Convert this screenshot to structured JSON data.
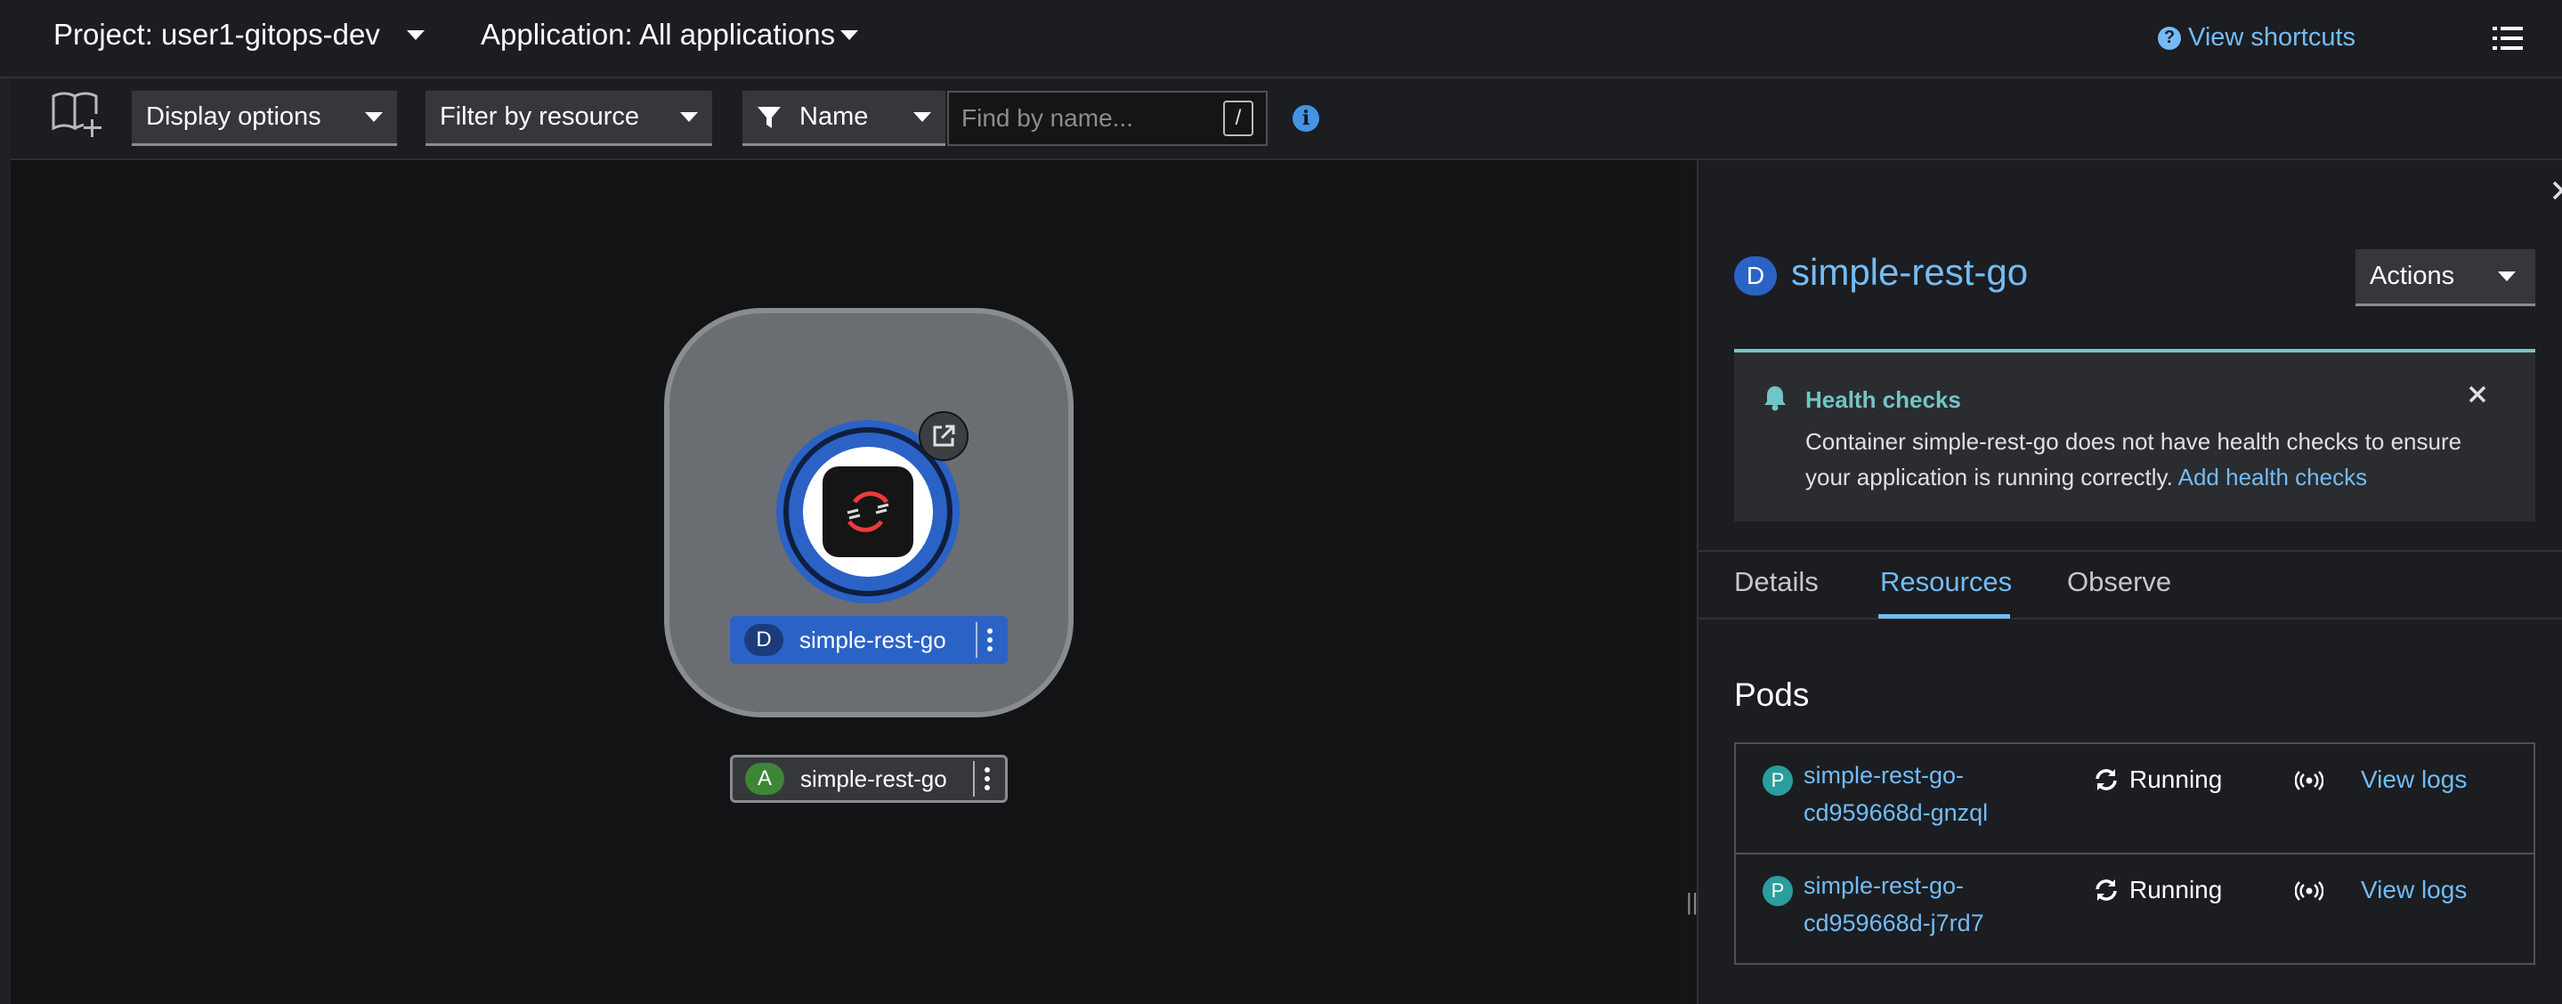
{
  "header": {
    "project_label": "Project: user1-gitops-dev",
    "application_label": "Application: All applications",
    "shortcuts_label": "View shortcuts"
  },
  "toolbar": {
    "display_options": "Display options",
    "filter_by_resource": "Filter by resource",
    "filter_type": "Name",
    "search_placeholder": "Find by name...",
    "search_shortcut": "/"
  },
  "topology": {
    "deployment": {
      "badge": "D",
      "name": "simple-rest-go"
    },
    "application": {
      "badge": "A",
      "name": "simple-rest-go"
    }
  },
  "panel": {
    "badge": "D",
    "title": "simple-rest-go",
    "actions_label": "Actions",
    "alert": {
      "title": "Health checks",
      "message": "Container simple-rest-go does not have health checks to ensure your application is running correctly.",
      "link": "Add health checks"
    },
    "tabs": [
      "Details",
      "Resources",
      "Observe"
    ],
    "active_tab": "Resources",
    "pods_heading": "Pods",
    "pods": [
      {
        "badge": "P",
        "name_line1": "simple-rest-go-",
        "name_line2": "cd959668d-gnzql",
        "status": "Running",
        "logs": "View logs"
      },
      {
        "badge": "P",
        "name_line1": "simple-rest-go-",
        "name_line2": "cd959668d-j7rd7",
        "status": "Running",
        "logs": "View logs"
      }
    ]
  },
  "colors": {
    "accent_link": "#73bcf7",
    "deployment_blue": "#2b62c6",
    "application_green": "#3e8635",
    "pod_teal": "#2a9d9d",
    "alert_teal": "#73c5c5"
  }
}
